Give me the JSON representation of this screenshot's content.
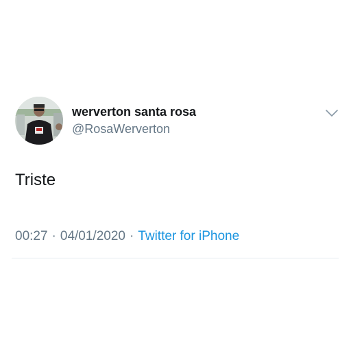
{
  "tweet": {
    "author": {
      "display_name": "werverton santa rosa",
      "handle": "@RosaWerverton"
    },
    "text": "Triste",
    "time": "00:27",
    "separator": "·",
    "date": "04/01/2020",
    "source": "Twitter for iPhone"
  },
  "colors": {
    "text": "#14171a",
    "secondary": "#657786",
    "link": "#1b95e0",
    "divider": "#e6ecf0"
  },
  "icons": {
    "menu": "chevron-down-icon"
  }
}
